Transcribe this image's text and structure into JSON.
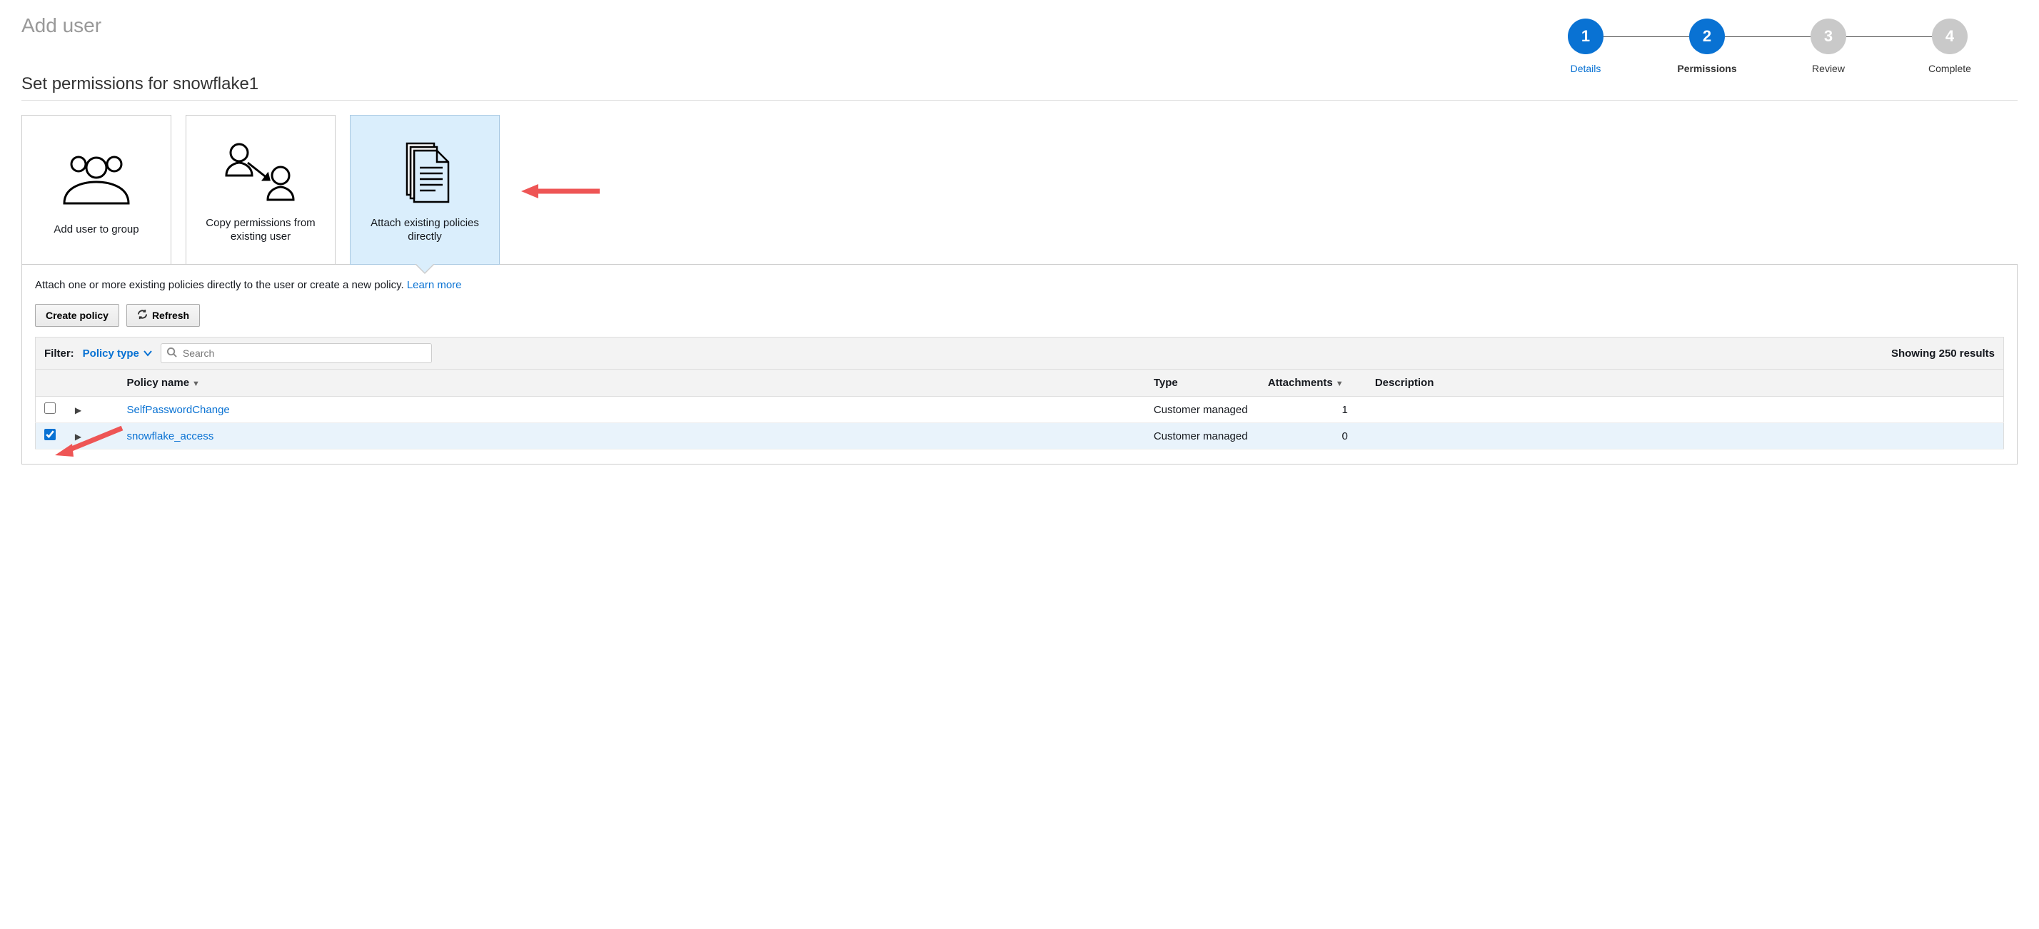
{
  "page_title": "Add user",
  "wizard": [
    {
      "num": "1",
      "label": "Details",
      "state": "complete"
    },
    {
      "num": "2",
      "label": "Permissions",
      "state": "active"
    },
    {
      "num": "3",
      "label": "Review",
      "state": "future"
    },
    {
      "num": "4",
      "label": "Complete",
      "state": "future"
    }
  ],
  "section_heading": "Set permissions for snowflake1",
  "cards": {
    "add_group": "Add user to group",
    "copy_user": "Copy permissions from existing user",
    "attach": "Attach existing policies directly"
  },
  "panel": {
    "intro_text": "Attach one or more existing policies directly to the user or create a new policy. ",
    "learn_more": "Learn more",
    "create_policy": "Create policy",
    "refresh": "Refresh",
    "filter_label": "Filter:",
    "policy_type": "Policy type",
    "search_placeholder": "Search",
    "results_text": "Showing 250 results",
    "cols": {
      "name": "Policy name",
      "type": "Type",
      "attach": "Attachments",
      "desc": "Description"
    },
    "rows": [
      {
        "checked": false,
        "name": "SelfPasswordChange",
        "type": "Customer managed",
        "attachments": "1",
        "desc": ""
      },
      {
        "checked": true,
        "name": "snowflake_access",
        "type": "Customer managed",
        "attachments": "0",
        "desc": ""
      }
    ]
  }
}
